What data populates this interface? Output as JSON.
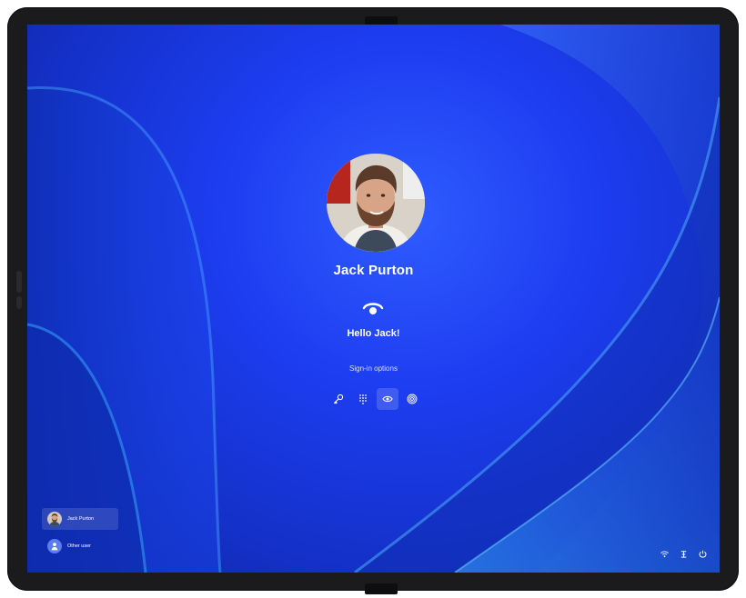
{
  "lock_screen": {
    "user_name": "Jack Purton",
    "greeting": "Hello Jack!",
    "sign_in_options_label": "Sign-in options",
    "sign_in_methods": [
      {
        "name": "key-icon",
        "selected": false
      },
      {
        "name": "pin-keypad-icon",
        "selected": false
      },
      {
        "name": "face-recognition-icon",
        "selected": true
      },
      {
        "name": "fingerprint-icon",
        "selected": false
      }
    ]
  },
  "user_switcher": {
    "users": [
      {
        "label": "Jack Purton",
        "selected": true
      },
      {
        "label": "Other user",
        "selected": false
      }
    ]
  },
  "system_tray": {
    "icons": [
      "wifi-icon",
      "accessibility-icon",
      "power-icon"
    ]
  },
  "colors": {
    "wallpaper_primary": "#1d3df0",
    "wallpaper_highlight": "#2f5cff",
    "text": "#ffffff"
  }
}
